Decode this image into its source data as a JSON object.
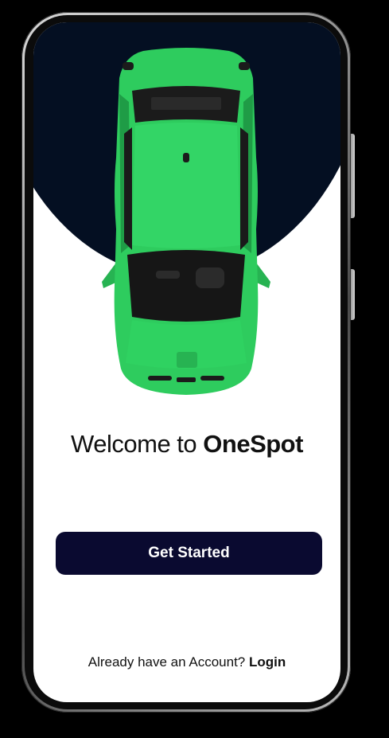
{
  "welcome": {
    "prefix": "Welcome to",
    "brand": "OneSpot"
  },
  "actions": {
    "get_started_label": "Get Started"
  },
  "footer": {
    "prompt": "Already have an Account?",
    "login_label": "Login"
  },
  "colors": {
    "hero_background": "#040f22",
    "button_background": "#0a0a30",
    "car_body": "#2ecc5e",
    "screen_background": "#ffffff"
  },
  "icons": {
    "hero_image": "green-car-top-view"
  }
}
